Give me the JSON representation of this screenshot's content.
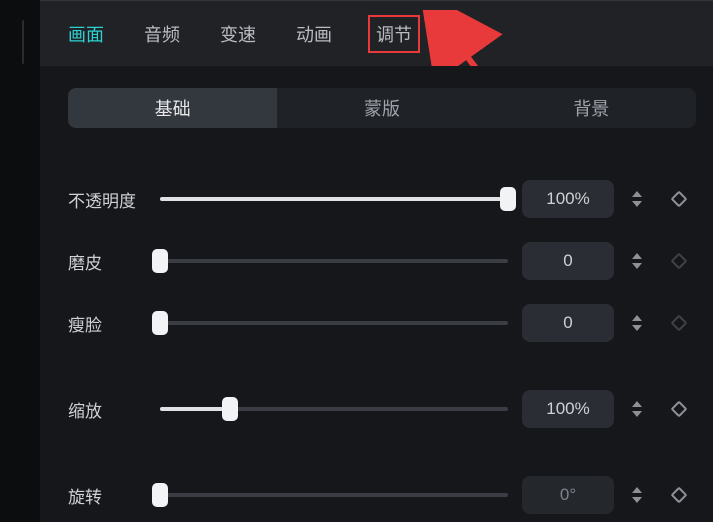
{
  "top_tabs": {
    "picture": "画面",
    "audio": "音频",
    "speed": "变速",
    "animation": "动画",
    "adjust": "调节"
  },
  "sub_tabs": {
    "basic": "基础",
    "mask": "蒙版",
    "background": "背景"
  },
  "rows": {
    "opacity": {
      "label": "不透明度",
      "value": "100%",
      "pct": 100
    },
    "smooth": {
      "label": "磨皮",
      "value": "0",
      "pct": 0
    },
    "slim_face": {
      "label": "瘦脸",
      "value": "0",
      "pct": 0
    },
    "scale": {
      "label": "缩放",
      "value": "100%",
      "pct": 20
    },
    "rotation": {
      "label": "旋转",
      "value": "0°",
      "pct": 0
    }
  },
  "chart_data": {
    "type": "table",
    "title": "Basic panel slider values",
    "series": [
      {
        "name": "不透明度",
        "raw": "100%",
        "slider_fraction": 1.0
      },
      {
        "name": "磨皮",
        "raw": "0",
        "slider_fraction": 0.0
      },
      {
        "name": "瘦脸",
        "raw": "0",
        "slider_fraction": 0.0
      },
      {
        "name": "缩放",
        "raw": "100%",
        "slider_fraction": 0.2
      },
      {
        "name": "旋转",
        "raw": "0°",
        "slider_fraction": 0.0
      }
    ]
  }
}
